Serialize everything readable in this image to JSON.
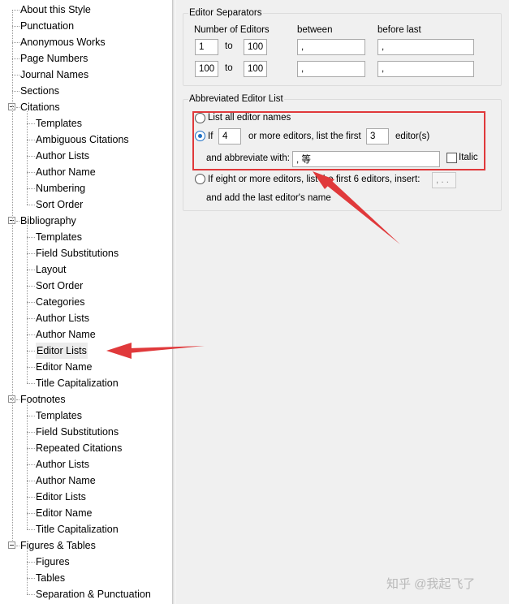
{
  "tree": [
    {
      "label": "About this Style",
      "level": 0,
      "toggle": false
    },
    {
      "label": "Punctuation",
      "level": 0,
      "toggle": false
    },
    {
      "label": "Anonymous Works",
      "level": 0,
      "toggle": false
    },
    {
      "label": "Page Numbers",
      "level": 0,
      "toggle": false
    },
    {
      "label": "Journal Names",
      "level": 0,
      "toggle": false
    },
    {
      "label": "Sections",
      "level": 0,
      "toggle": false
    },
    {
      "label": "Citations",
      "level": 0,
      "toggle": true
    },
    {
      "label": "Templates",
      "level": 1,
      "toggle": false
    },
    {
      "label": "Ambiguous Citations",
      "level": 1,
      "toggle": false
    },
    {
      "label": "Author Lists",
      "level": 1,
      "toggle": false
    },
    {
      "label": "Author Name",
      "level": 1,
      "toggle": false
    },
    {
      "label": "Numbering",
      "level": 1,
      "toggle": false
    },
    {
      "label": "Sort Order",
      "level": 1,
      "toggle": false
    },
    {
      "label": "Bibliography",
      "level": 0,
      "toggle": true
    },
    {
      "label": "Templates",
      "level": 1,
      "toggle": false
    },
    {
      "label": "Field Substitutions",
      "level": 1,
      "toggle": false
    },
    {
      "label": "Layout",
      "level": 1,
      "toggle": false
    },
    {
      "label": "Sort Order",
      "level": 1,
      "toggle": false
    },
    {
      "label": "Categories",
      "level": 1,
      "toggle": false
    },
    {
      "label": "Author Lists",
      "level": 1,
      "toggle": false
    },
    {
      "label": "Author Name",
      "level": 1,
      "toggle": false
    },
    {
      "label": "Editor Lists",
      "level": 1,
      "toggle": false,
      "selected": true
    },
    {
      "label": "Editor Name",
      "level": 1,
      "toggle": false
    },
    {
      "label": "Title Capitalization",
      "level": 1,
      "toggle": false
    },
    {
      "label": "Footnotes",
      "level": 0,
      "toggle": true
    },
    {
      "label": "Templates",
      "level": 1,
      "toggle": false
    },
    {
      "label": "Field Substitutions",
      "level": 1,
      "toggle": false
    },
    {
      "label": "Repeated Citations",
      "level": 1,
      "toggle": false
    },
    {
      "label": "Author Lists",
      "level": 1,
      "toggle": false
    },
    {
      "label": "Author Name",
      "level": 1,
      "toggle": false
    },
    {
      "label": "Editor Lists",
      "level": 1,
      "toggle": false
    },
    {
      "label": "Editor Name",
      "level": 1,
      "toggle": false
    },
    {
      "label": "Title Capitalization",
      "level": 1,
      "toggle": false
    },
    {
      "label": "Figures & Tables",
      "level": 0,
      "toggle": true
    },
    {
      "label": "Figures",
      "level": 1,
      "toggle": false
    },
    {
      "label": "Tables",
      "level": 1,
      "toggle": false
    },
    {
      "label": "Separation & Punctuation",
      "level": 1,
      "toggle": false
    }
  ],
  "separators": {
    "title": "Editor Separators",
    "col_number": "Number of Editors",
    "col_between": "between",
    "col_before_last": "before last",
    "to_label": "to",
    "rows": [
      {
        "from": "1",
        "to": "100",
        "between": ",",
        "before_last": ","
      },
      {
        "from": "100",
        "to": "100",
        "between": ",",
        "before_last": ","
      }
    ]
  },
  "abbrev": {
    "title": "Abbreviated Editor List",
    "option_all": "List all editor names",
    "if_label": "If",
    "if_count": "4",
    "more_label": "or more editors, list the first",
    "first_count": "3",
    "editors_label": "editor(s)",
    "abbreviate_label": "and abbreviate with:",
    "abbreviate_value": ", 等",
    "italic_label": "Italic",
    "option_eight": "If eight or more editors, list the first 6 editors, insert:",
    "insert_value": ", . . .",
    "add_last_label": "and add the last editor's name",
    "selected_option": "if"
  },
  "annotation_color": "#e0393b",
  "accent_color": "#1e6fc4",
  "watermark": "知乎 @我起飞了"
}
